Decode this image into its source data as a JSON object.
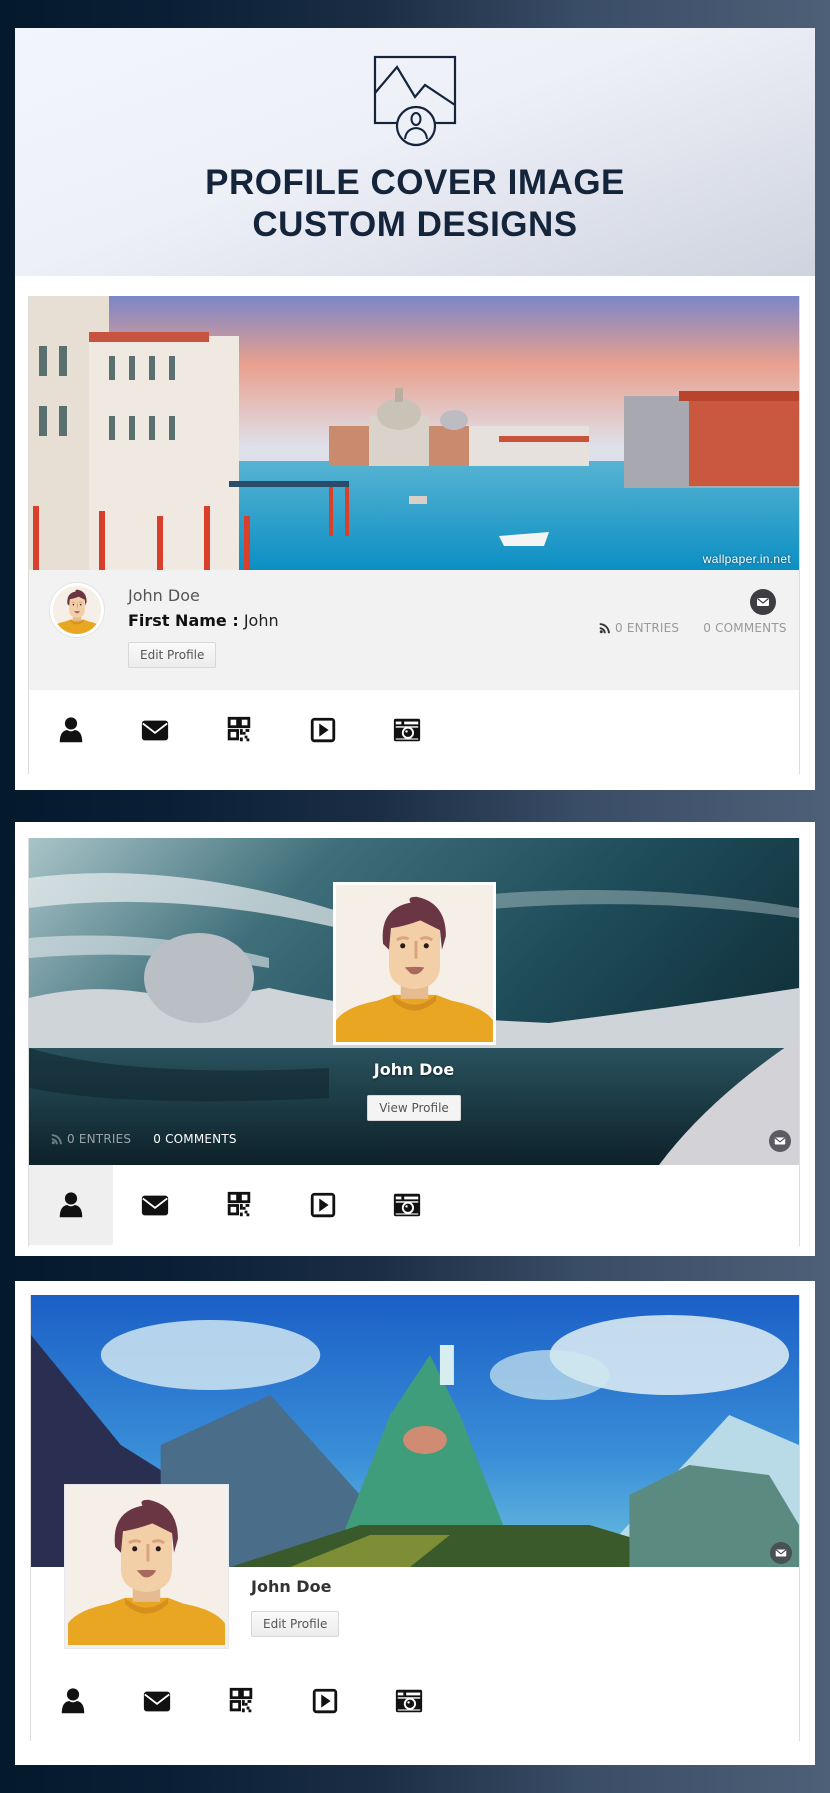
{
  "header": {
    "icon": "profile-cover-image-icon",
    "title_line1": "PROFILE COVER IMAGE",
    "title_line2": "CUSTOM DESIGNS"
  },
  "colors": {
    "background_dark": "#05192d",
    "background_light": "#4e6078",
    "title": "#14243a",
    "info_band": "#f2f2f2",
    "avatar_shirt": "#e8a623",
    "avatar_hair": "#6b3644"
  },
  "designs": [
    {
      "cover_theme": "venice-grand-canal",
      "watermark": "wallpaper.in.net",
      "user_name": "John Doe",
      "field_label": "First Name :",
      "field_value": "John",
      "button_label": "Edit Profile",
      "entries_label": "0 ENTRIES",
      "comments_label": "0 COMMENTS",
      "message_icon": "envelope-icon",
      "nav_icons": [
        "user-icon",
        "envelope-icon",
        "qr-code-icon",
        "video-play-icon",
        "camera-icon"
      ],
      "active_nav": null
    },
    {
      "cover_theme": "frozen-lake-landscape",
      "user_name": "John Doe",
      "button_label": "View Profile",
      "entries_label": "0 ENTRIES",
      "comments_label": "0 COMMENTS",
      "message_icon": "envelope-icon",
      "nav_icons": [
        "user-icon",
        "envelope-icon",
        "qr-code-icon",
        "video-play-icon",
        "camera-icon"
      ],
      "active_nav": "user-icon"
    },
    {
      "cover_theme": "fantasy-mountain-castle",
      "user_name": "John Doe",
      "button_label": "Edit Profile",
      "message_icon": "envelope-icon",
      "nav_icons": [
        "user-icon",
        "envelope-icon",
        "qr-code-icon",
        "video-play-icon",
        "camera-icon"
      ],
      "active_nav": null
    }
  ]
}
